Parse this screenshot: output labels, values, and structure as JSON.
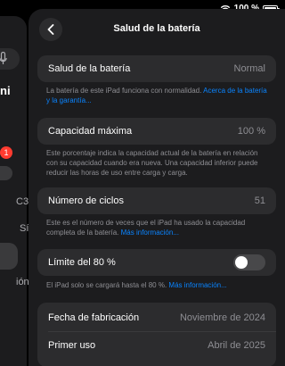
{
  "status_bar": {
    "battery_percent": "100 %",
    "battery_level": 1.0
  },
  "sidebar": {
    "fragment_title": "ni",
    "badge": "1",
    "item_c3": "C3",
    "item_si": "Sí",
    "item_ion": "ión"
  },
  "header": {
    "title": "Salud de la batería"
  },
  "health": {
    "label": "Salud de la batería",
    "value": "Normal",
    "note": "La batería de este iPad funciona con normalidad.",
    "link": "Acerca de la batería y la garantía..."
  },
  "capacity": {
    "label": "Capacidad máxima",
    "value": "100 %",
    "note": "Este porcentaje indica la capacidad actual de la batería en relación con su capacidad cuando era nueva. Una capacidad inferior puede reducir las horas de uso entre carga y carga."
  },
  "cycles": {
    "label": "Número de ciclos",
    "value": "51",
    "note": "Este es el número de veces que el iPad ha usado la capacidad completa de la batería.",
    "link": "Más información..."
  },
  "limit": {
    "label": "Límite del 80 %",
    "enabled": false,
    "note": "El iPad solo se cargará hasta el 80 %.",
    "link": "Más información..."
  },
  "dates": {
    "manufacture_label": "Fecha de fabricación",
    "manufacture_value": "Noviembre de 2024",
    "first_use_label": "Primer uso",
    "first_use_value": "Abril de 2025"
  }
}
